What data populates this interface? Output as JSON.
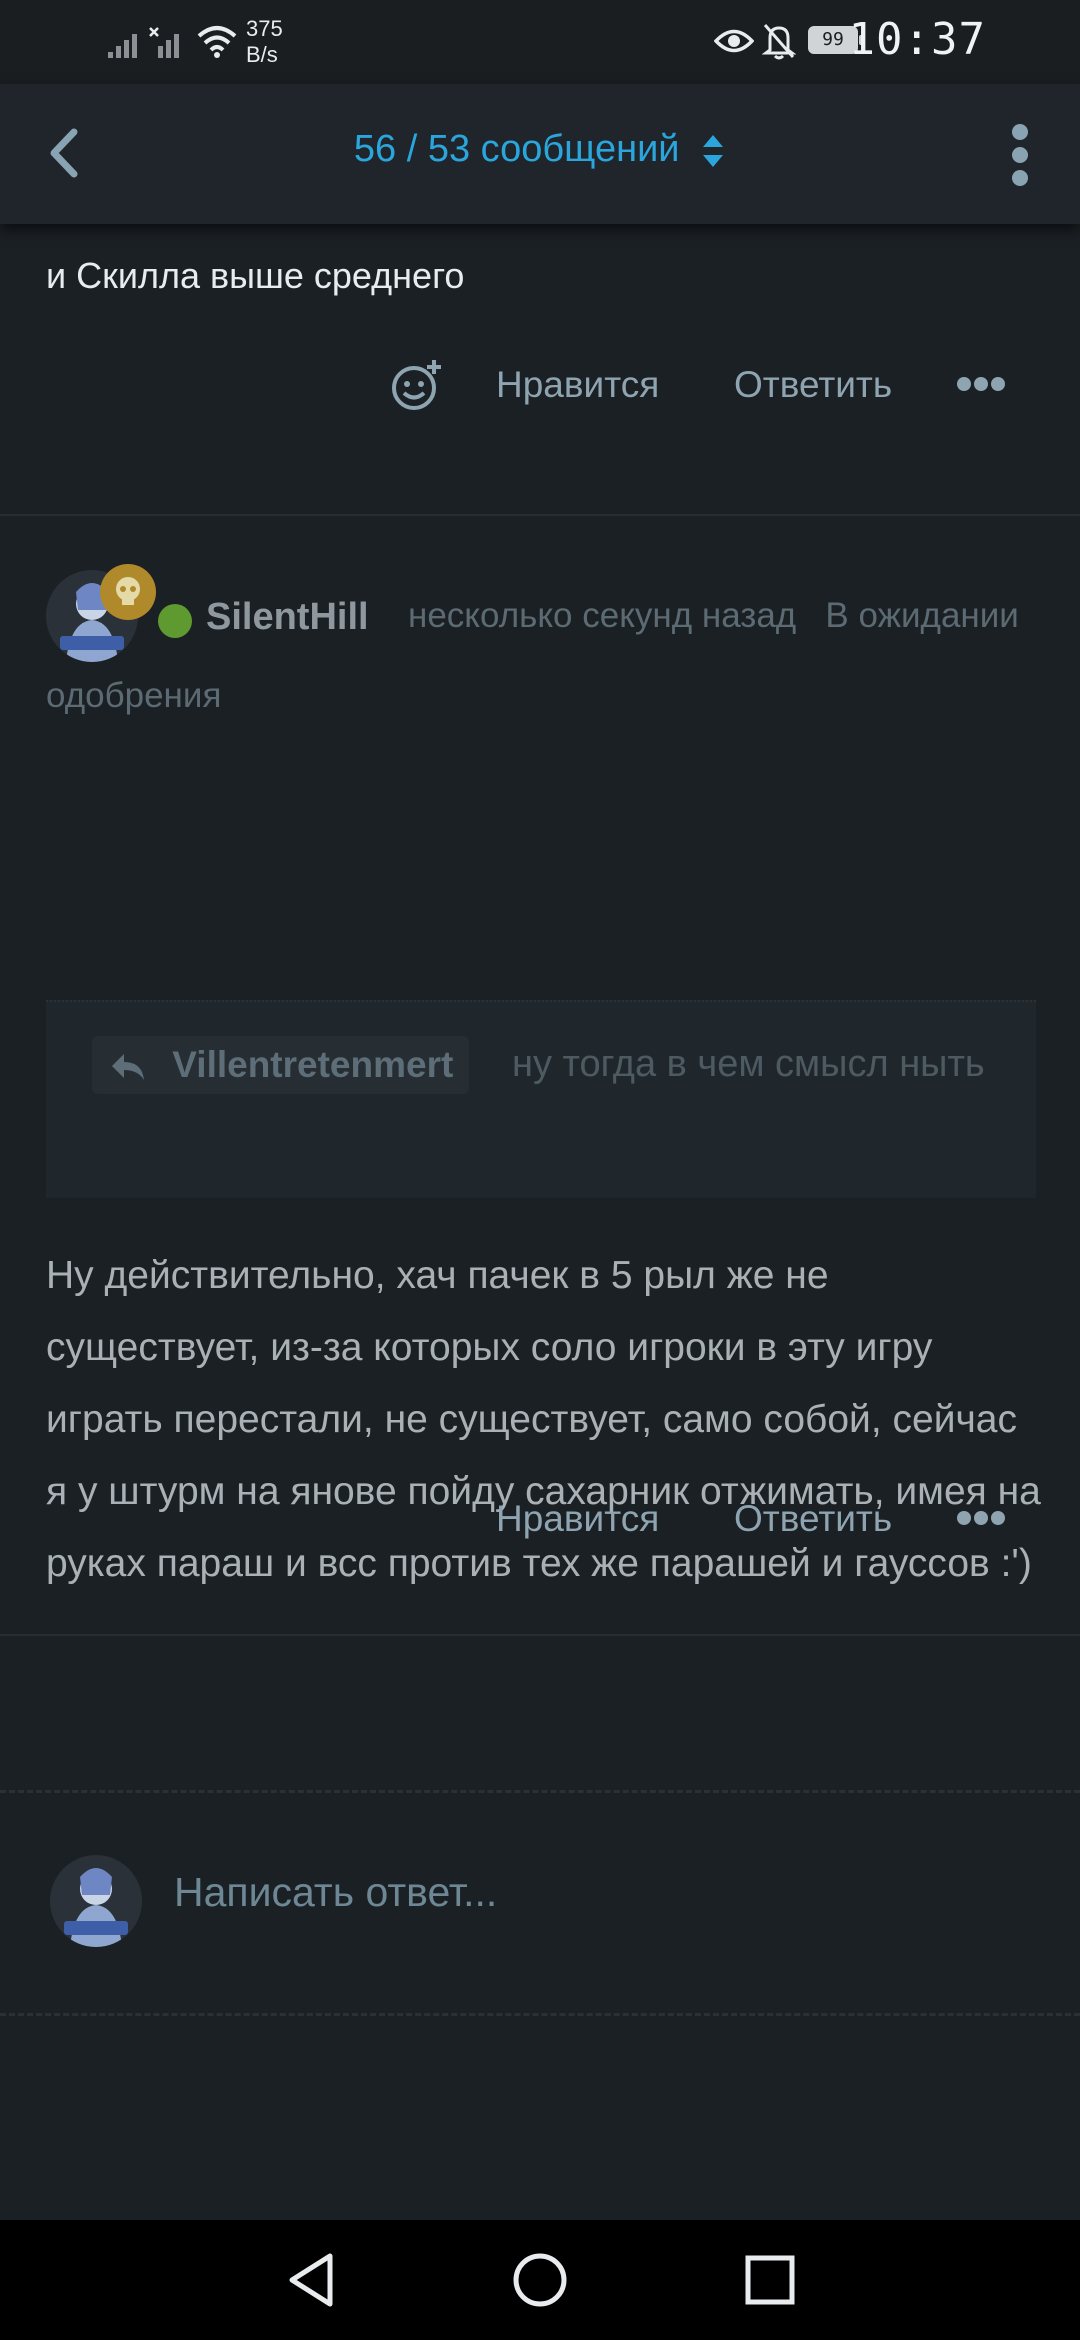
{
  "status_bar": {
    "net_speed_value": "375",
    "net_speed_unit": "B/s",
    "battery": "99",
    "time": "10:37"
  },
  "header": {
    "title": "56 / 53 сообщений"
  },
  "prev_post": {
    "text_tail": "и Скилла выше среднего",
    "like": "Нравится",
    "reply": "Ответить"
  },
  "post": {
    "username": "SilentHill",
    "time": "несколько секунд назад",
    "status": "В ожидании одобрения",
    "quote": {
      "author": "Villentretenmert",
      "text": "ну тогда в чем смысл ныть"
    },
    "body": "Ну действительно, хач пачек в 5 рыл же не существует, из-за которых соло игроки в эту игру играть перестали, не существует, само собой, сейчас я у штурм на янове пойду сахарник отжимать, имея на руках параш и всс против тех же парашей и гауссов :')",
    "like": "Нравится",
    "reply": "Ответить"
  },
  "reply_box": {
    "placeholder": "Написать ответ..."
  },
  "colors": {
    "accent": "#2aa6dc",
    "background": "#1b2024",
    "online": "#5e9a2f",
    "badge": "#b08a2a"
  }
}
